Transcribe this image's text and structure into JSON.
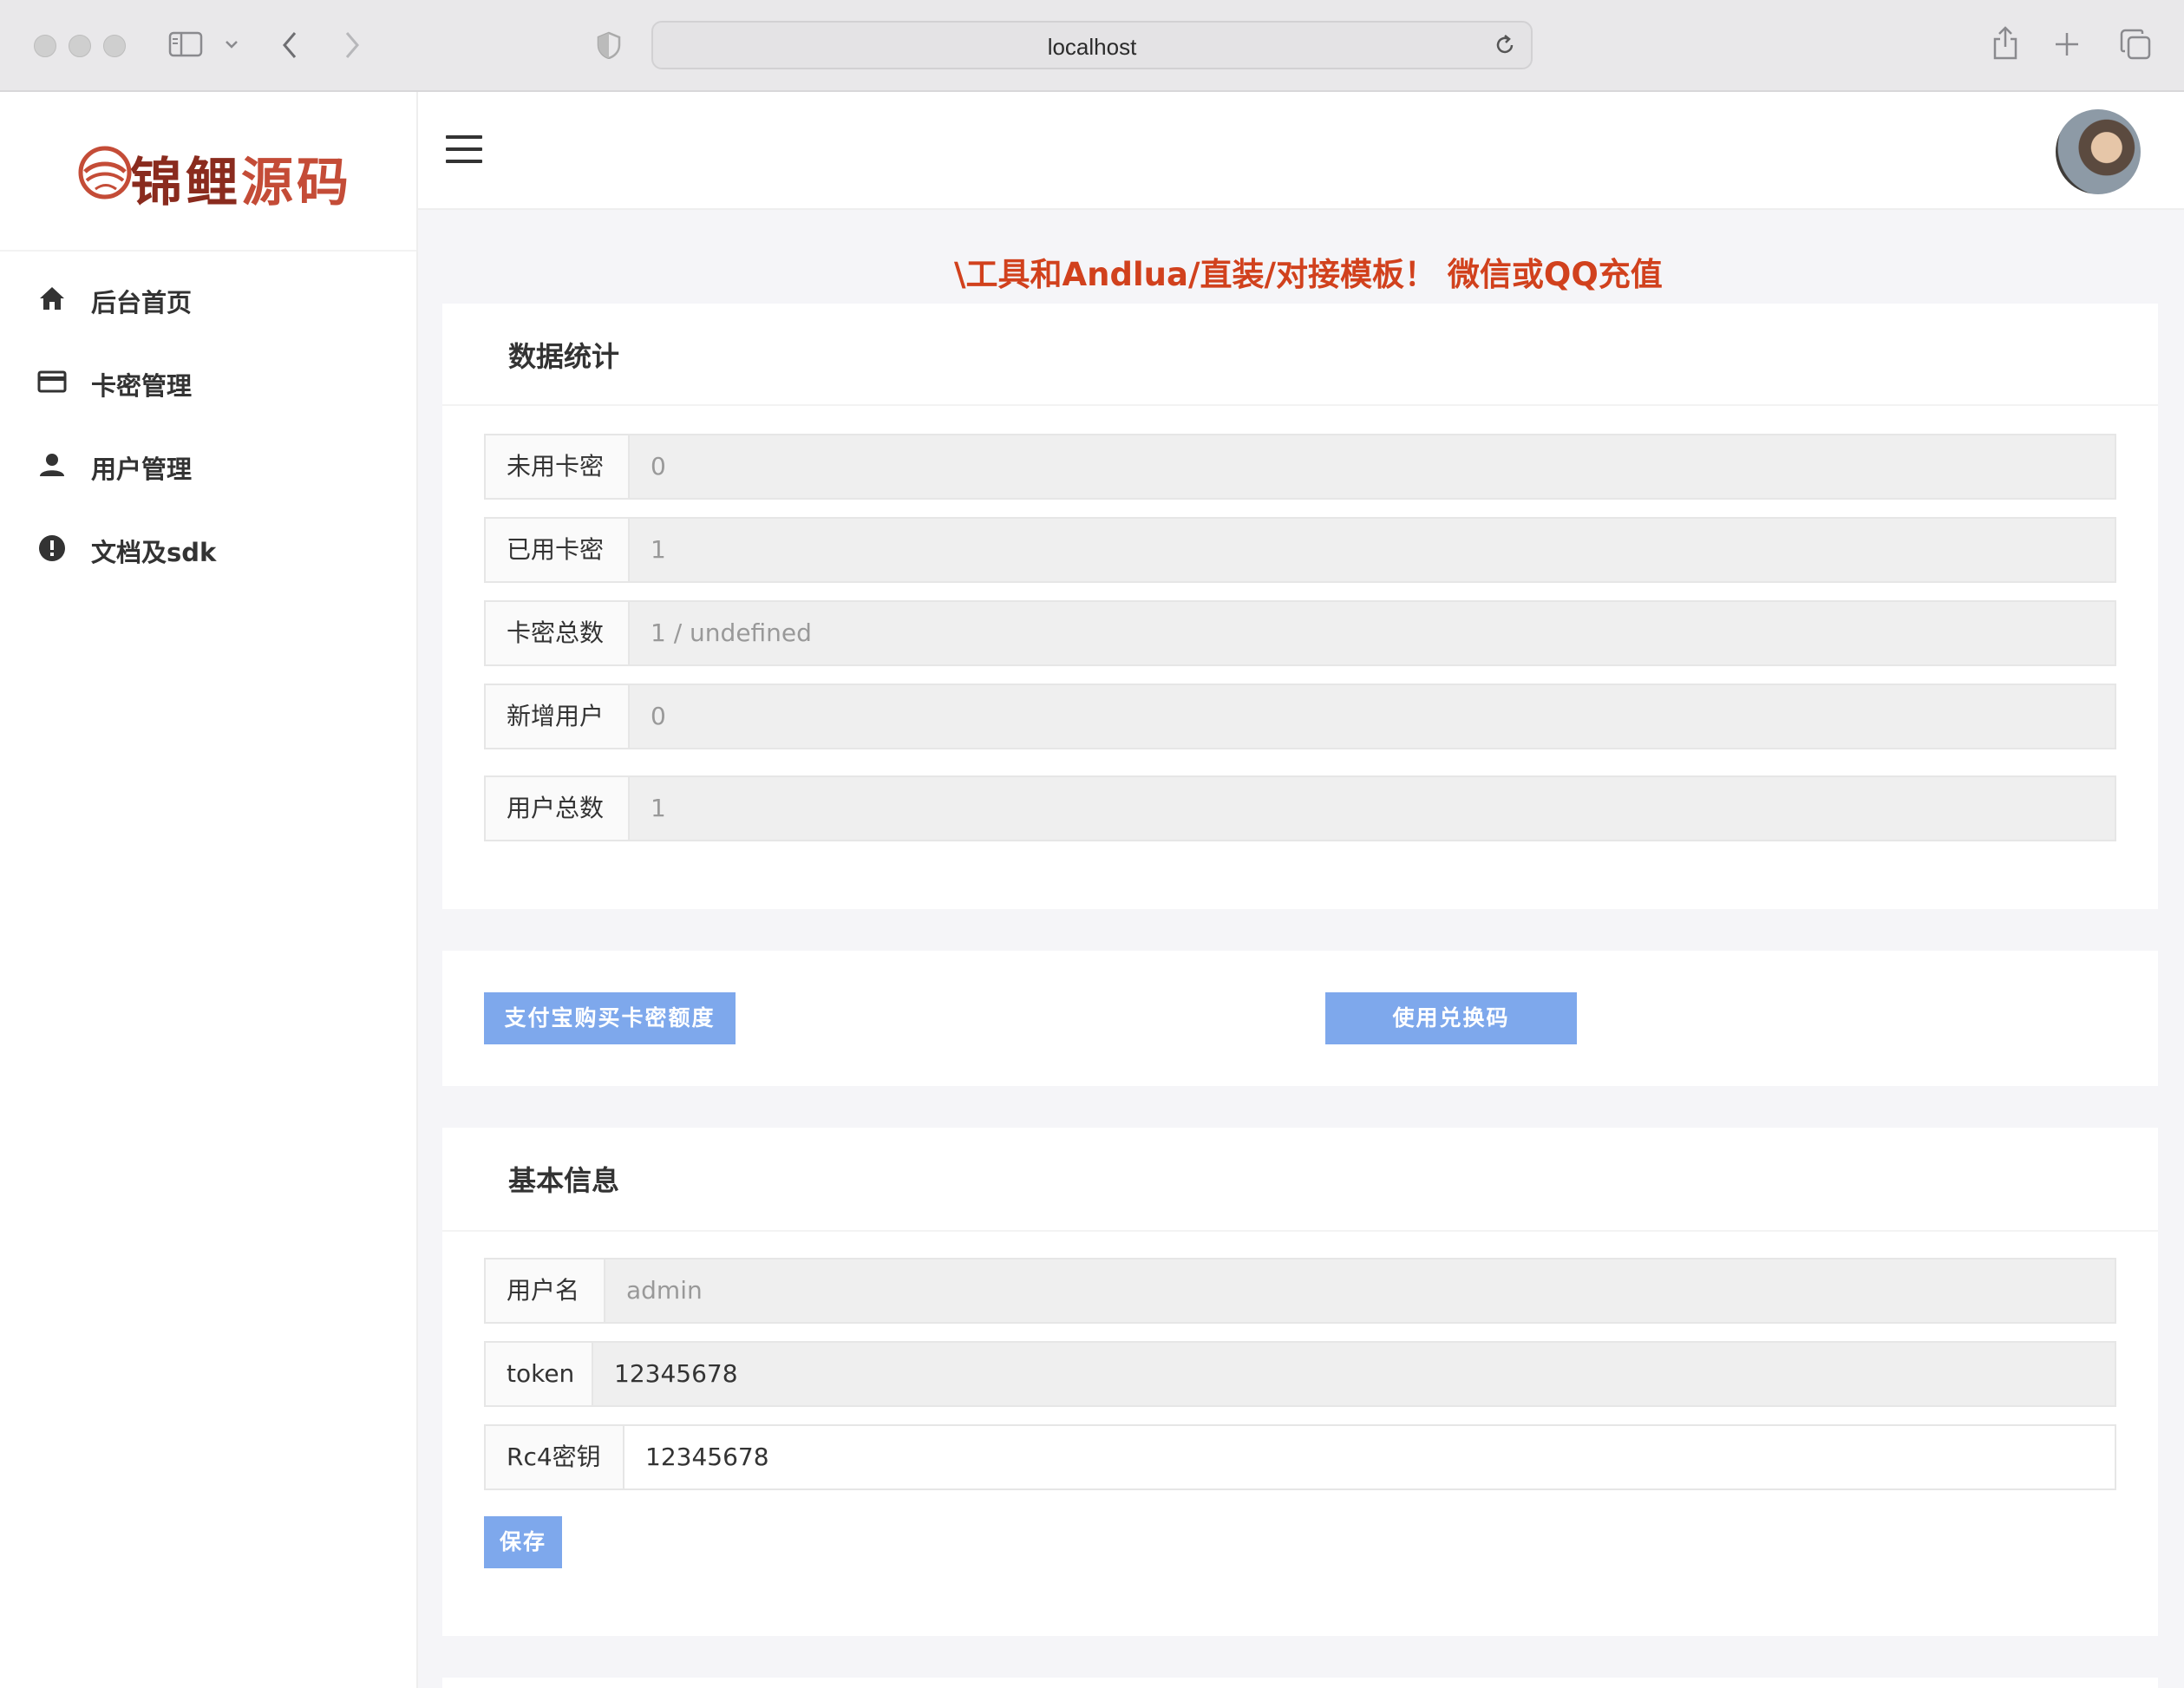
{
  "browser": {
    "url": "localhost"
  },
  "brand": {
    "name_part1": "锦鲤",
    "name_part2": "源码",
    "accent_color": "#c44c37"
  },
  "sidebar": {
    "items": [
      {
        "label": "后台首页",
        "icon": "home-icon"
      },
      {
        "label": "卡密管理",
        "icon": "card-icon"
      },
      {
        "label": "用户管理",
        "icon": "user-icon"
      },
      {
        "label": "文档及sdk",
        "icon": "alert-circle-icon"
      }
    ]
  },
  "marquee": {
    "text": "\\工具和Andlua/直装/对接模板！ 微信或QQ充值"
  },
  "stats": {
    "title": "数据统计",
    "rows": [
      {
        "label": "未用卡密",
        "value": "0"
      },
      {
        "label": "已用卡密",
        "value": "1"
      },
      {
        "label": "卡密总数",
        "value": "1 / undefined"
      },
      {
        "label": "新增用户",
        "value": "0"
      },
      {
        "label": "用户总数",
        "value": "1"
      }
    ]
  },
  "actions": {
    "alipay_label": "支付宝购买卡密额度",
    "redeem_label": "使用兑换码"
  },
  "basic_info": {
    "title": "基本信息",
    "username_label": "用户名",
    "username_value": "admin",
    "token_label": "token",
    "token_value": "12345678",
    "rc4_label": "Rc4密钥",
    "rc4_value": "12345678",
    "save_label": "保存"
  },
  "colors": {
    "button": "#7ea8ec",
    "marquee": "#d1411d"
  }
}
